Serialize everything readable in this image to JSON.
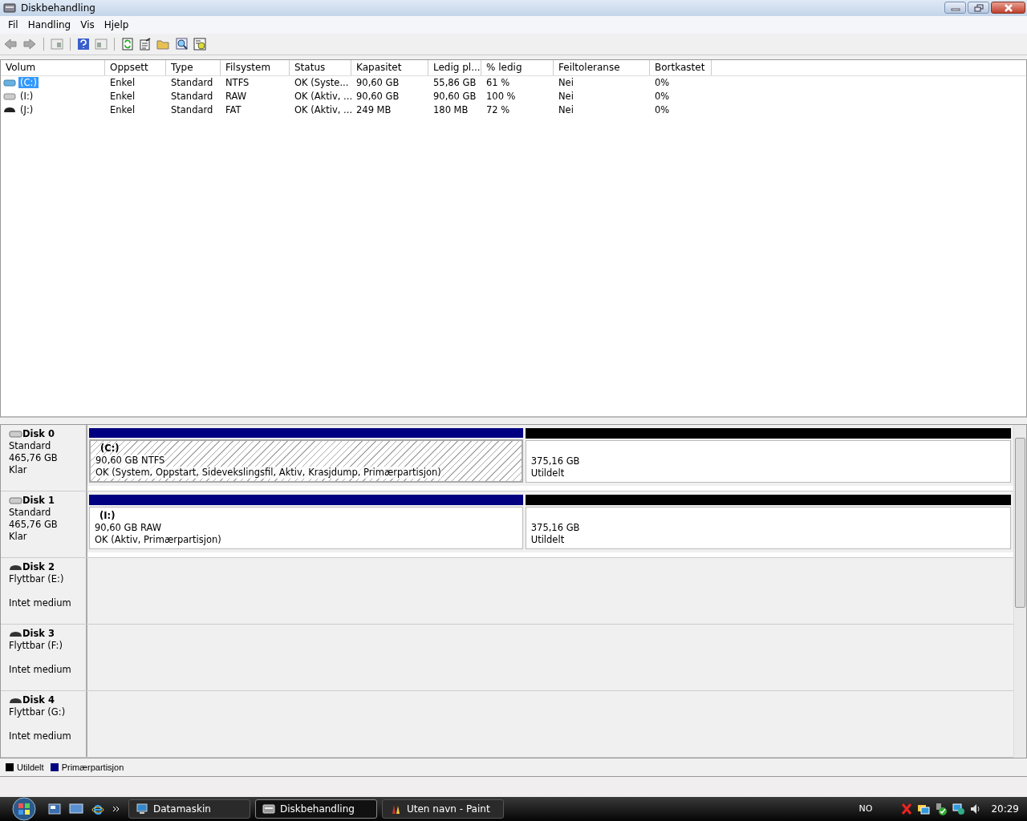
{
  "window": {
    "title": "Diskbehandling"
  },
  "menu": [
    "Fil",
    "Handling",
    "Vis",
    "Hjelp"
  ],
  "table": {
    "columns": [
      "Volum",
      "Oppsett",
      "Type",
      "Filsystem",
      "Status",
      "Kapasitet",
      "Ledig pl...",
      "% ledig",
      "Feiltoleranse",
      "Bortkastet"
    ],
    "rows": [
      {
        "kind": "fixed",
        "selected": true,
        "cells": [
          "(C:)",
          "Enkel",
          "Standard",
          "NTFS",
          "OK (Syste...",
          "90,60 GB",
          "55,86 GB",
          "61 %",
          "Nei",
          "0%"
        ]
      },
      {
        "kind": "fixed",
        "selected": false,
        "cells": [
          "(I:)",
          "Enkel",
          "Standard",
          "RAW",
          "OK (Aktiv, ...",
          "90,60 GB",
          "90,60 GB",
          "100 %",
          "Nei",
          "0%"
        ]
      },
      {
        "kind": "removable",
        "selected": false,
        "cells": [
          "(J:)",
          "Enkel",
          "Standard",
          "FAT",
          "OK (Aktiv, ...",
          "249 MB",
          "180 MB",
          "72 %",
          "Nei",
          "0%"
        ]
      }
    ]
  },
  "disks": [
    {
      "kind": "fixed",
      "name": "Disk 0",
      "type": "Standard",
      "size": "465,76 GB",
      "state": "Klar",
      "partitions": [
        {
          "kind": "primary",
          "selected": true,
          "label": "(C:)",
          "size": "90,60 GB NTFS",
          "status": "OK (System, Oppstart, Sidevekslingsfil, Aktiv, Krasjdump, Primærpartisjon)"
        },
        {
          "kind": "unallocated",
          "selected": false,
          "size": "375,16 GB",
          "status": "Utildelt"
        }
      ]
    },
    {
      "kind": "fixed",
      "name": "Disk 1",
      "type": "Standard",
      "size": "465,76 GB",
      "state": "Klar",
      "partitions": [
        {
          "kind": "primary",
          "selected": false,
          "label": "(I:)",
          "size": "90,60 GB RAW",
          "status": "OK (Aktiv, Primærpartisjon)"
        },
        {
          "kind": "unallocated",
          "selected": false,
          "size": "375,16 GB",
          "status": "Utildelt"
        }
      ]
    },
    {
      "kind": "removable",
      "name": "Disk 2",
      "type": "Flyttbar (E:)",
      "state": "Intet medium"
    },
    {
      "kind": "removable",
      "name": "Disk 3",
      "type": "Flyttbar (F:)",
      "state": "Intet medium"
    },
    {
      "kind": "removable",
      "name": "Disk 4",
      "type": "Flyttbar (G:)",
      "state": "Intet medium"
    }
  ],
  "legend": [
    {
      "label": "Utildelt",
      "color": "#000000"
    },
    {
      "label": "Primærpartisjon",
      "color": "#000080"
    }
  ],
  "taskbar": {
    "tasks": [
      {
        "label": "Datamaskin",
        "selected": false
      },
      {
        "label": "Diskbehandling",
        "selected": true
      },
      {
        "label": "Uten navn - Paint",
        "selected": false
      }
    ],
    "language": "NO",
    "time": "20:29"
  }
}
